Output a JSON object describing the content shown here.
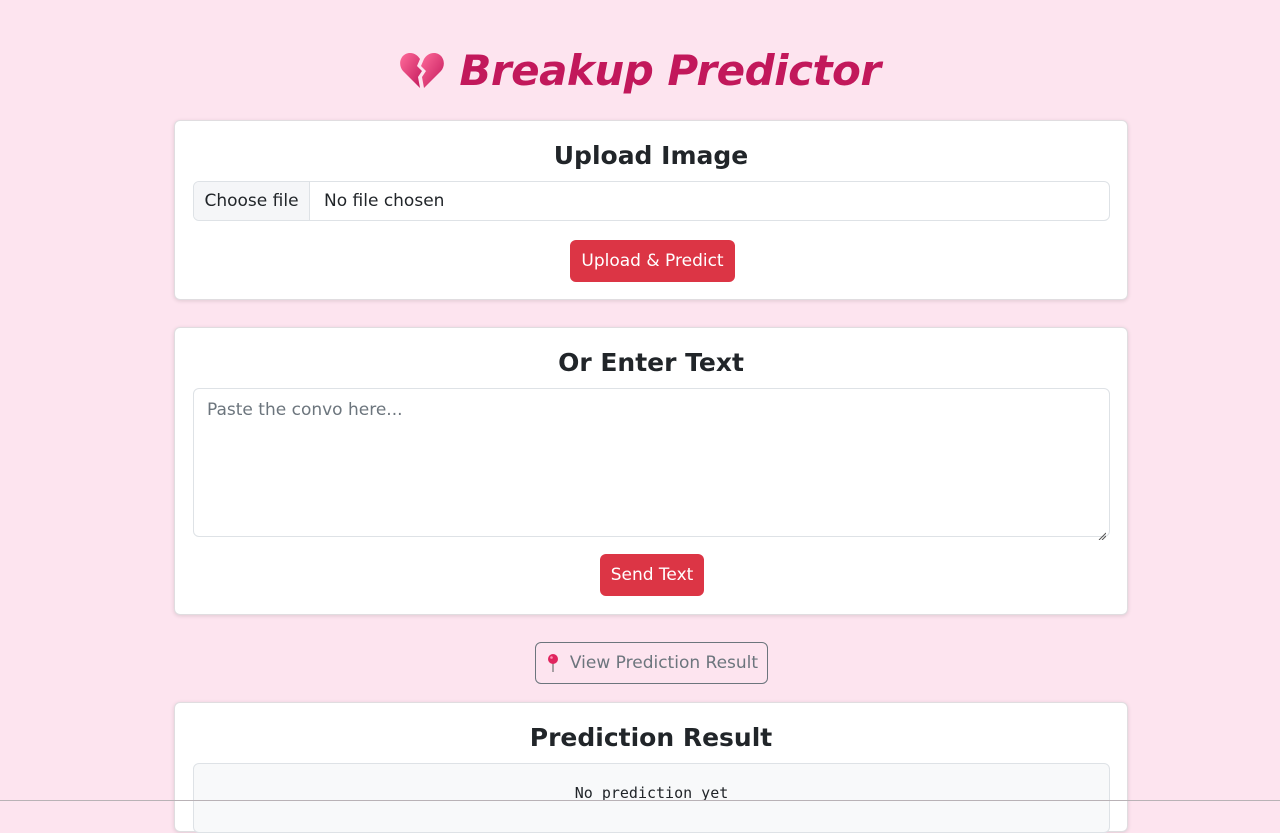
{
  "header": {
    "title": "Breakup Predictor",
    "icon": "broken-heart-icon"
  },
  "upload_section": {
    "title": "Upload Image",
    "choose_file_label": "Choose file",
    "file_status": "No file chosen",
    "submit_label": "Upload & Predict"
  },
  "text_section": {
    "title": "Or Enter Text",
    "placeholder": "Paste the convo here...",
    "submit_label": "Send Text"
  },
  "view_result": {
    "label": "View Prediction Result",
    "icon": "pushpin-icon"
  },
  "result_section": {
    "title": "Prediction Result",
    "output": "No prediction yet"
  },
  "colors": {
    "page_background": "#fde4ef",
    "title": "#c2185b",
    "primary_button": "#dc3545"
  }
}
